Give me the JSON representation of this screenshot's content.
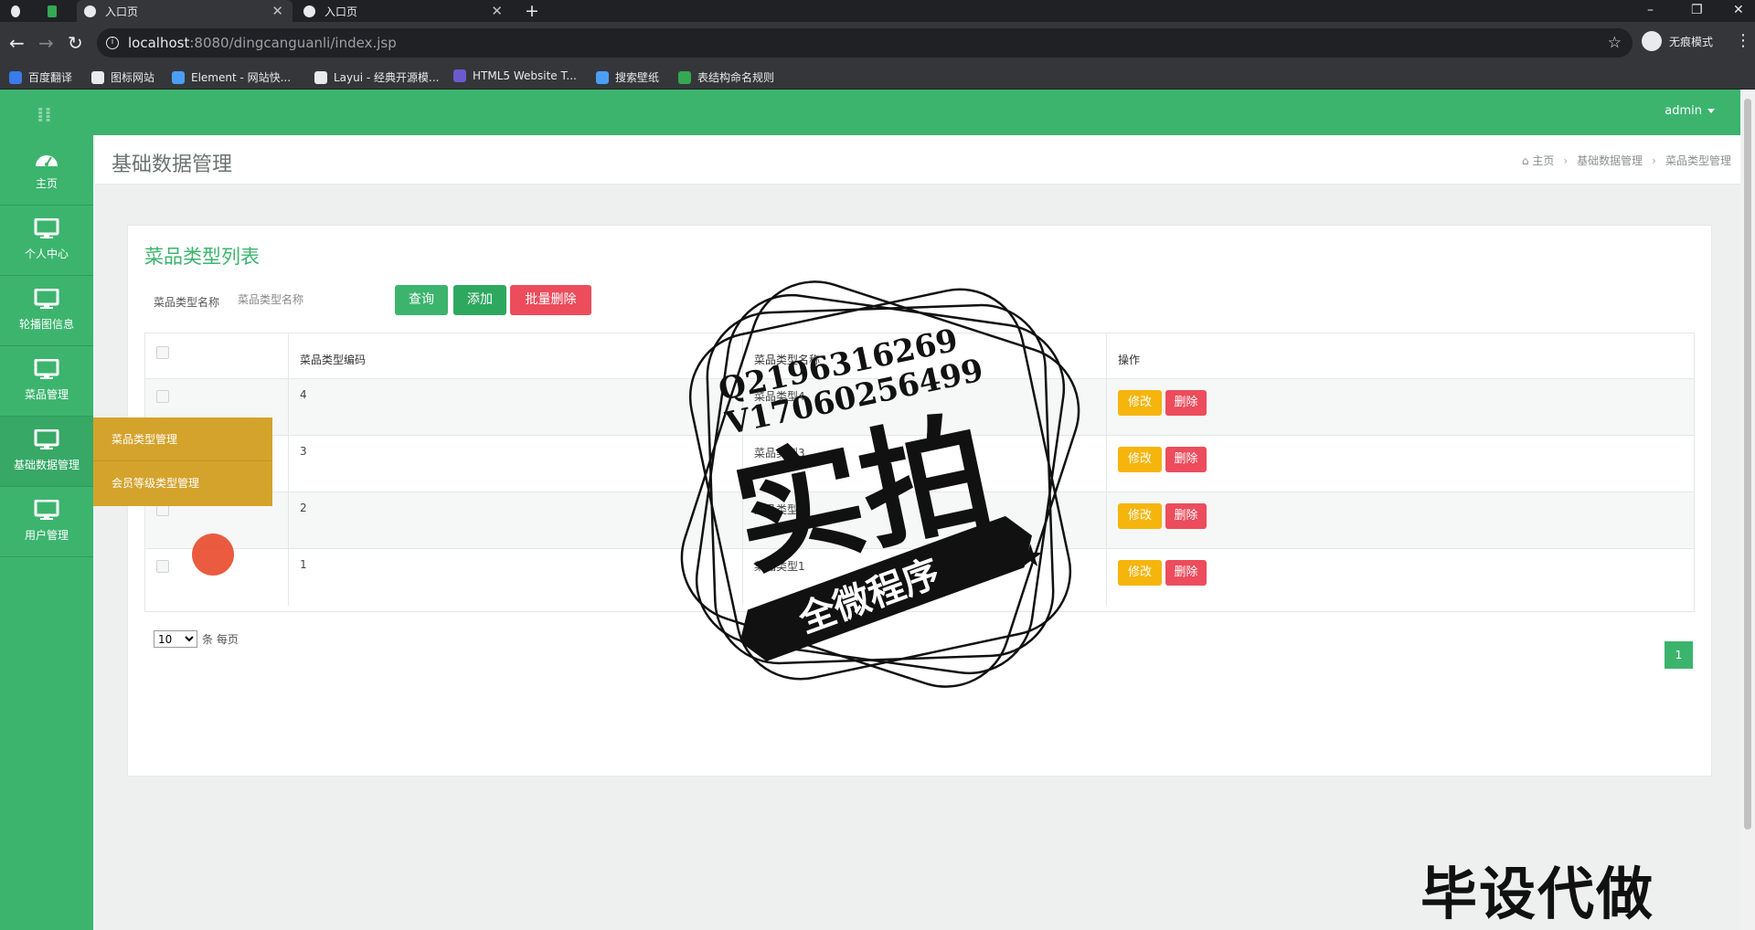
{
  "browser": {
    "tabs": [
      {
        "label": ""
      },
      {
        "label": ""
      },
      {
        "label": "入口页"
      },
      {
        "label": "入口页"
      }
    ],
    "new_tab": "+",
    "url_host": "localhost",
    "url_path": ":8080/dingcanguanli/index.jsp",
    "incognito_label": "无痕模式",
    "window_controls": [
      "–",
      "❐",
      "✕"
    ],
    "bookmarks": [
      {
        "label": "百度翻译",
        "color": "#3b7bea"
      },
      {
        "label": "图标网站",
        "color": "#e8eaed"
      },
      {
        "label": "Element - 网站快...",
        "color": "#4a9ff5"
      },
      {
        "label": "Layui - 经典开源模...",
        "color": "#e8eaed"
      },
      {
        "label": "HTML5 Website T...",
        "color": "#6a5acd"
      },
      {
        "label": "搜索壁纸",
        "color": "#4a9ff5"
      },
      {
        "label": "表结构命名规则",
        "color": "#34a853"
      }
    ]
  },
  "app": {
    "user_menu": "admin",
    "accent": "#3cb46e",
    "sidebar": [
      {
        "label": "主页",
        "icon": "dashboard-icon"
      },
      {
        "label": "个人中心",
        "icon": "monitor-icon"
      },
      {
        "label": "轮播图信息",
        "icon": "monitor-icon"
      },
      {
        "label": "菜品管理",
        "icon": "monitor-icon"
      },
      {
        "label": "基础数据管理",
        "icon": "monitor-icon"
      },
      {
        "label": "用户管理",
        "icon": "monitor-icon"
      }
    ],
    "flyout": [
      {
        "label": "菜品类型管理"
      },
      {
        "label": "会员等级类型管理"
      }
    ],
    "page_title": "基础数据管理",
    "breadcrumb": [
      "主页",
      "基础数据管理",
      "菜品类型管理"
    ],
    "panel_title": "菜品类型列表",
    "search": {
      "label": "菜品类型名称",
      "placeholder": "菜品类型名称"
    },
    "buttons": {
      "query": "查询",
      "add": "添加",
      "batch_delete": "批量删除"
    },
    "table": {
      "headers": [
        "菜品类型编码",
        "菜品类型名称",
        "操作"
      ],
      "rows": [
        {
          "code": "4",
          "name": "菜品类型4"
        },
        {
          "code": "3",
          "name": "菜品类型3"
        },
        {
          "code": "2",
          "name": "菜品类型2"
        },
        {
          "code": "1",
          "name": "菜品类型1"
        }
      ],
      "edit_label": "修改",
      "delete_label": "删除"
    },
    "pagination": {
      "page_size": "10",
      "per_page_label": "条 每页",
      "current_page": "1"
    }
  },
  "overlays": {
    "stamp_lines": [
      "Q2196316269",
      "V17060256499"
    ],
    "stamp_main": "实拍",
    "stamp_banner": "全微程序",
    "watermark": "毕设代做"
  }
}
